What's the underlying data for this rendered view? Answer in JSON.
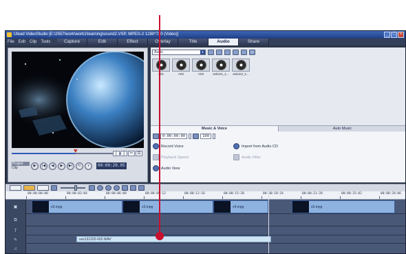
{
  "window": {
    "title": "Ulead VideoStudio [E:\\2557\\work\\work1\\learning\\sound2.VSP, MPEG-2 1280*720 (Video)]",
    "minimize": "_",
    "maximize": "□",
    "close": "×"
  },
  "menu": [
    "File",
    "Edit",
    "Clip",
    "Tools"
  ],
  "steps": [
    {
      "label": "Capture",
      "active": false
    },
    {
      "label": "Edit",
      "active": false
    },
    {
      "label": "Effect",
      "active": false
    },
    {
      "label": "Overlay",
      "active": false
    },
    {
      "label": "Title",
      "active": false
    },
    {
      "label": "Audio",
      "active": true
    },
    {
      "label": "Share",
      "active": false
    }
  ],
  "preview": {
    "mode_project": "Project",
    "mode_clip": "Clip",
    "timecode": "00:00:20.05",
    "position_fraction": 0.58,
    "mark_in": "[",
    "mark_out": "]"
  },
  "library": {
    "category": "Audio",
    "items": [
      "A01",
      "A02",
      "A03",
      "action1_1...",
      "action2_1..."
    ]
  },
  "options": {
    "tabs": [
      "Music & Voice",
      "Auto Music"
    ],
    "active_tab": "Music & Voice",
    "timecode": "0:00:00:00",
    "volume": "100",
    "record_voice": "Record Voice",
    "import_cd": "Import from Audio CD",
    "playback_speed": "Playback Speed",
    "audio_filter": "Audio Filter",
    "audio_view": "Audio View"
  },
  "timeline": {
    "ruler": [
      "00:00:00:00",
      "00:00:03:04",
      "00:00:06:08",
      "00:00:09:12",
      "00:00:12:16",
      "00:00:15:20",
      "00:00:18:24",
      "00:00:21:28",
      "00:00:25:02",
      "00:00:28:06",
      "00:00:31"
    ],
    "video_clips": [
      "v0.mpg",
      "v3.mpg",
      "v4.mpg",
      "v5.mpg"
    ],
    "audio_clip": "uvs131220-002.WAV"
  },
  "colors": {
    "accent": "#c8102e",
    "window_bg": "#2c3648",
    "clip": "#8fb3e0",
    "audio_clip": "#cfe4f3"
  }
}
